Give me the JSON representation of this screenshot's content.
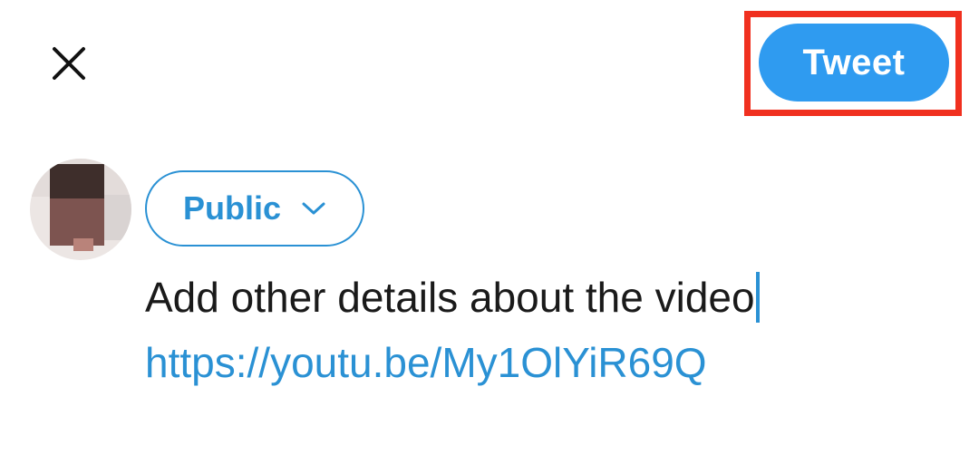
{
  "header": {
    "tweet_label": "Tweet",
    "close_icon": "close-icon"
  },
  "composer": {
    "audience_label": "Public",
    "audience_icon": "chevron-down-icon",
    "text_line": "Add other details about the video",
    "link": "https://youtu.be/My1OlYiR69Q"
  },
  "colors": {
    "accent": "#2f9bf0",
    "link": "#2a91d4",
    "highlight": "#f0301f"
  }
}
